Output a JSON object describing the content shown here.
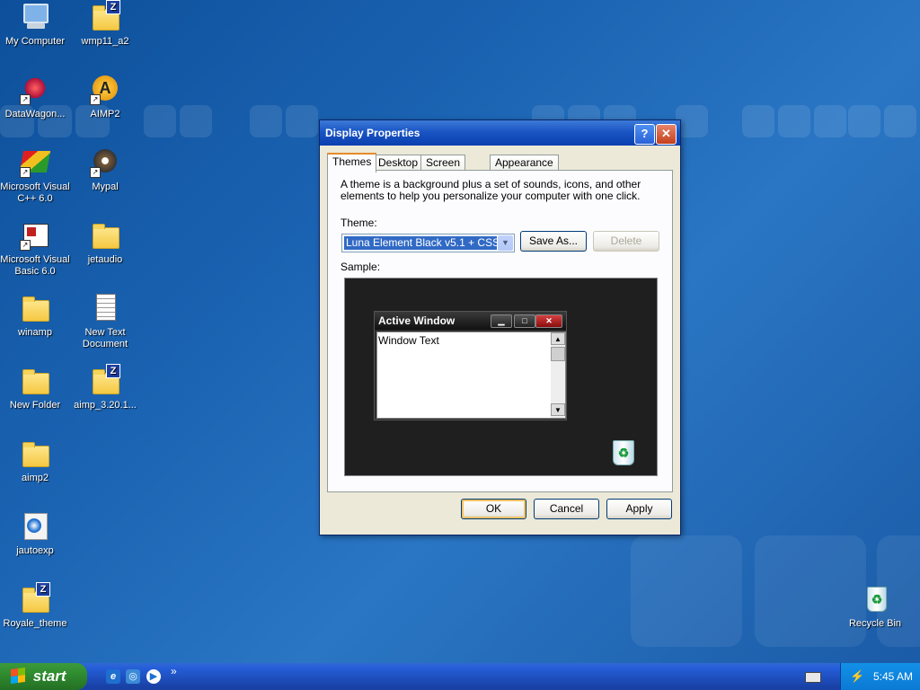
{
  "desktop": {
    "icons_left": [
      {
        "label": "My Computer",
        "icon": "computer-icon"
      },
      {
        "label": "DataWagon...",
        "icon": "datawagon-icon"
      },
      {
        "label": "Microsoft Visual C++ 6.0",
        "icon": "visual-cpp-icon"
      },
      {
        "label": "Microsoft Visual Basic 6.0",
        "icon": "visual-basic-icon"
      },
      {
        "label": "winamp",
        "icon": "folder-icon"
      },
      {
        "label": "New Folder",
        "icon": "folder-icon"
      },
      {
        "label": "aimp2",
        "icon": "folder-icon"
      },
      {
        "label": "jautoexp",
        "icon": "jautoexp-icon"
      },
      {
        "label": "Royale_theme",
        "icon": "zip-folder-icon"
      }
    ],
    "icons_right": [
      {
        "label": "wmp11_a2",
        "icon": "zip-folder-icon"
      },
      {
        "label": "AIMP2",
        "icon": "aimp-icon"
      },
      {
        "label": "Mypal",
        "icon": "mypal-icon"
      },
      {
        "label": "jetaudio",
        "icon": "folder-icon"
      },
      {
        "label": "New Text Document",
        "icon": "text-document-icon"
      },
      {
        "label": "aimp_3.20.1...",
        "icon": "zip-folder-icon"
      }
    ],
    "recycle_bin": {
      "label": "Recycle Bin",
      "icon": "recycle-bin-icon"
    }
  },
  "dialog": {
    "title": "Display Properties",
    "help_label": "?",
    "close_label": "✕",
    "tabs": [
      {
        "label": "Themes",
        "active": true
      },
      {
        "label": "Desktop"
      },
      {
        "label": "Screen Saver"
      },
      {
        "label": "Appearance"
      }
    ],
    "description": "A theme is a background plus a set of sounds, icons, and other elements to help you personalize your computer with one click.",
    "theme_label": "Theme:",
    "theme_value": "Luna Element Black v5.1 + CSS",
    "save_as_label": "Save As...",
    "delete_label": "Delete",
    "sample_label": "Sample:",
    "sample": {
      "window_title": "Active Window",
      "window_text": "Window Text"
    },
    "ok_label": "OK",
    "cancel_label": "Cancel",
    "apply_label": "Apply"
  },
  "taskbar": {
    "start_label": "start",
    "quick_launch": [
      "internet-explorer-icon",
      "media-icon",
      "media-player-icon"
    ],
    "chevron": "»",
    "clock": "5:45 AM"
  },
  "colors": {
    "desktop_blue": "#1b64b3",
    "title_blue": "#0b3fb0",
    "start_green": "#2f8c2f",
    "selection_blue": "#316ac5"
  }
}
